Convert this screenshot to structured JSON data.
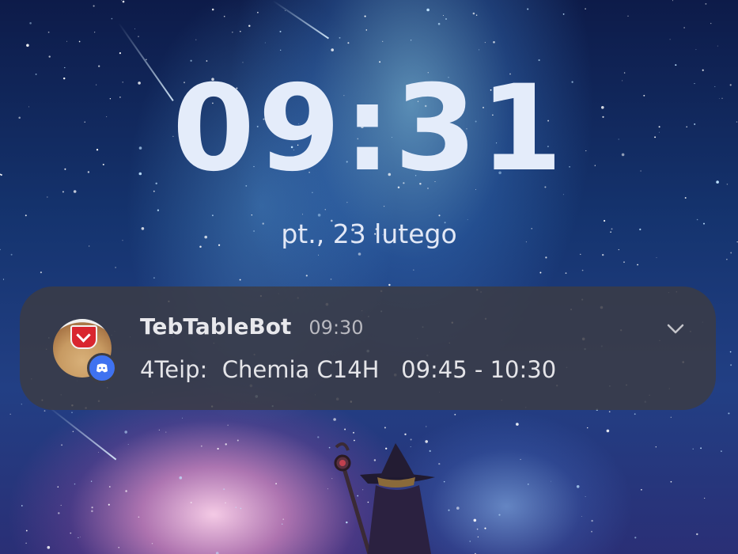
{
  "lockscreen": {
    "time": "09:31",
    "date": "pt., 23 lutego"
  },
  "notification": {
    "app_name": "TebTableBot",
    "time": "09:30",
    "message": "4Teip:  Chemia C14H   09:45 - 10:30",
    "icons": {
      "app": "bot-avatar-icon",
      "badge": "discord-icon",
      "expand": "chevron-down-icon"
    }
  },
  "colors": {
    "clock": "#e4ecfa",
    "notification_bg": "#3c3c44",
    "badge": "#3f72f0"
  }
}
